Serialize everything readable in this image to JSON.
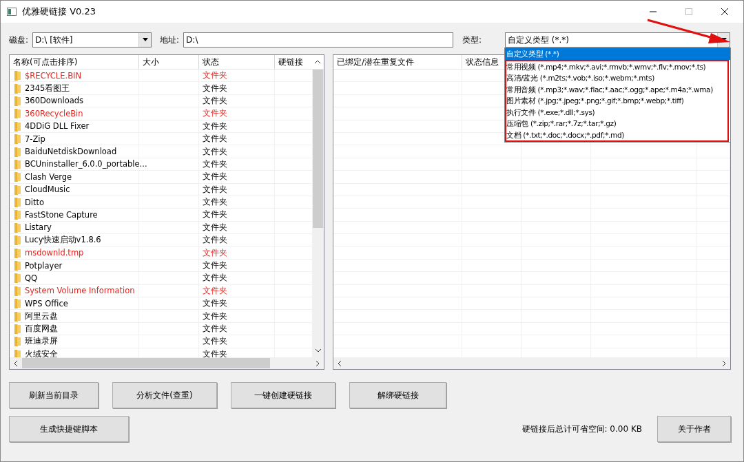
{
  "window": {
    "title": "优雅硬链接 V0.23"
  },
  "disk": {
    "label": "磁盘:",
    "value": "D:\\ [软件]"
  },
  "address": {
    "label": "地址:",
    "value": "D:\\"
  },
  "type": {
    "label": "类型:",
    "value": "自定义类型 (*.*)",
    "expanded": true,
    "options": [
      {
        "label": "自定义类型 (*.*)",
        "selected": true
      },
      {
        "label": "常用视频 (*.mp4;*.mkv;*.avi;*.rmvb;*.wmv;*.flv;*.mov;*.ts)",
        "selected": false
      },
      {
        "label": "高清/蓝光 (*.m2ts;*.vob;*.iso;*.webm;*.mts)",
        "selected": false
      },
      {
        "label": "常用音频 (*.mp3;*.wav;*.flac;*.aac;*.ogg;*.ape;*.m4a;*.wma)",
        "selected": false
      },
      {
        "label": "图片素材 (*.jpg;*.jpeg;*.png;*.gif;*.bmp;*.webp;*.tiff)",
        "selected": false
      },
      {
        "label": "执行文件 (*.exe;*.dll;*.sys)",
        "selected": false
      },
      {
        "label": "压缩包 (*.zip;*.rar;*.7z;*.tar;*.gz)",
        "selected": false
      },
      {
        "label": "文档 (*.txt;*.doc;*.docx;*.pdf;*.md)",
        "selected": false
      }
    ]
  },
  "file_list": {
    "columns": [
      "名称(可点击排序)",
      "大小",
      "状态",
      "硬链接"
    ],
    "rows": [
      {
        "name": "$RECYCLE.BIN",
        "status": "文件夹",
        "protected": true
      },
      {
        "name": "2345看图王",
        "status": "文件夹",
        "protected": false
      },
      {
        "name": "360Downloads",
        "status": "文件夹",
        "protected": false
      },
      {
        "name": "360RecycleBin",
        "status": "文件夹",
        "protected": true
      },
      {
        "name": "4DDiG DLL Fixer",
        "status": "文件夹",
        "protected": false
      },
      {
        "name": "7-Zip",
        "status": "文件夹",
        "protected": false
      },
      {
        "name": "BaiduNetdiskDownload",
        "status": "文件夹",
        "protected": false
      },
      {
        "name": "BCUninstaller_6.0.0_portable...",
        "status": "文件夹",
        "protected": false
      },
      {
        "name": "Clash Verge",
        "status": "文件夹",
        "protected": false
      },
      {
        "name": "CloudMusic",
        "status": "文件夹",
        "protected": false
      },
      {
        "name": "Ditto",
        "status": "文件夹",
        "protected": false
      },
      {
        "name": "FastStone Capture",
        "status": "文件夹",
        "protected": false
      },
      {
        "name": "Listary",
        "status": "文件夹",
        "protected": false
      },
      {
        "name": "Lucy快速启动v1.8.6",
        "status": "文件夹",
        "protected": false
      },
      {
        "name": "msdownld.tmp",
        "status": "文件夹",
        "protected": true
      },
      {
        "name": "Potplayer",
        "status": "文件夹",
        "protected": false
      },
      {
        "name": "QQ",
        "status": "文件夹",
        "protected": false
      },
      {
        "name": "System Volume Information",
        "status": "文件夹",
        "protected": true
      },
      {
        "name": "WPS Office",
        "status": "文件夹",
        "protected": false
      },
      {
        "name": "阿里云盘",
        "status": "文件夹",
        "protected": false
      },
      {
        "name": "百度网盘",
        "status": "文件夹",
        "protected": false
      },
      {
        "name": "班迪录屏",
        "status": "文件夹",
        "protected": false
      },
      {
        "name": "火绒安全",
        "status": "文件夹",
        "protected": false
      }
    ]
  },
  "result_list": {
    "columns": [
      "已绑定/潜在重复文件",
      "状态信息"
    ]
  },
  "buttons": [
    "刷新当前目录",
    "分析文件(查重)",
    "一键创建硬链接",
    "解绑硬链接"
  ],
  "script_button": "生成快捷键脚本",
  "savings": "硬链接后总计可省空间: 0.00 KB",
  "about_button": "关于作者"
}
